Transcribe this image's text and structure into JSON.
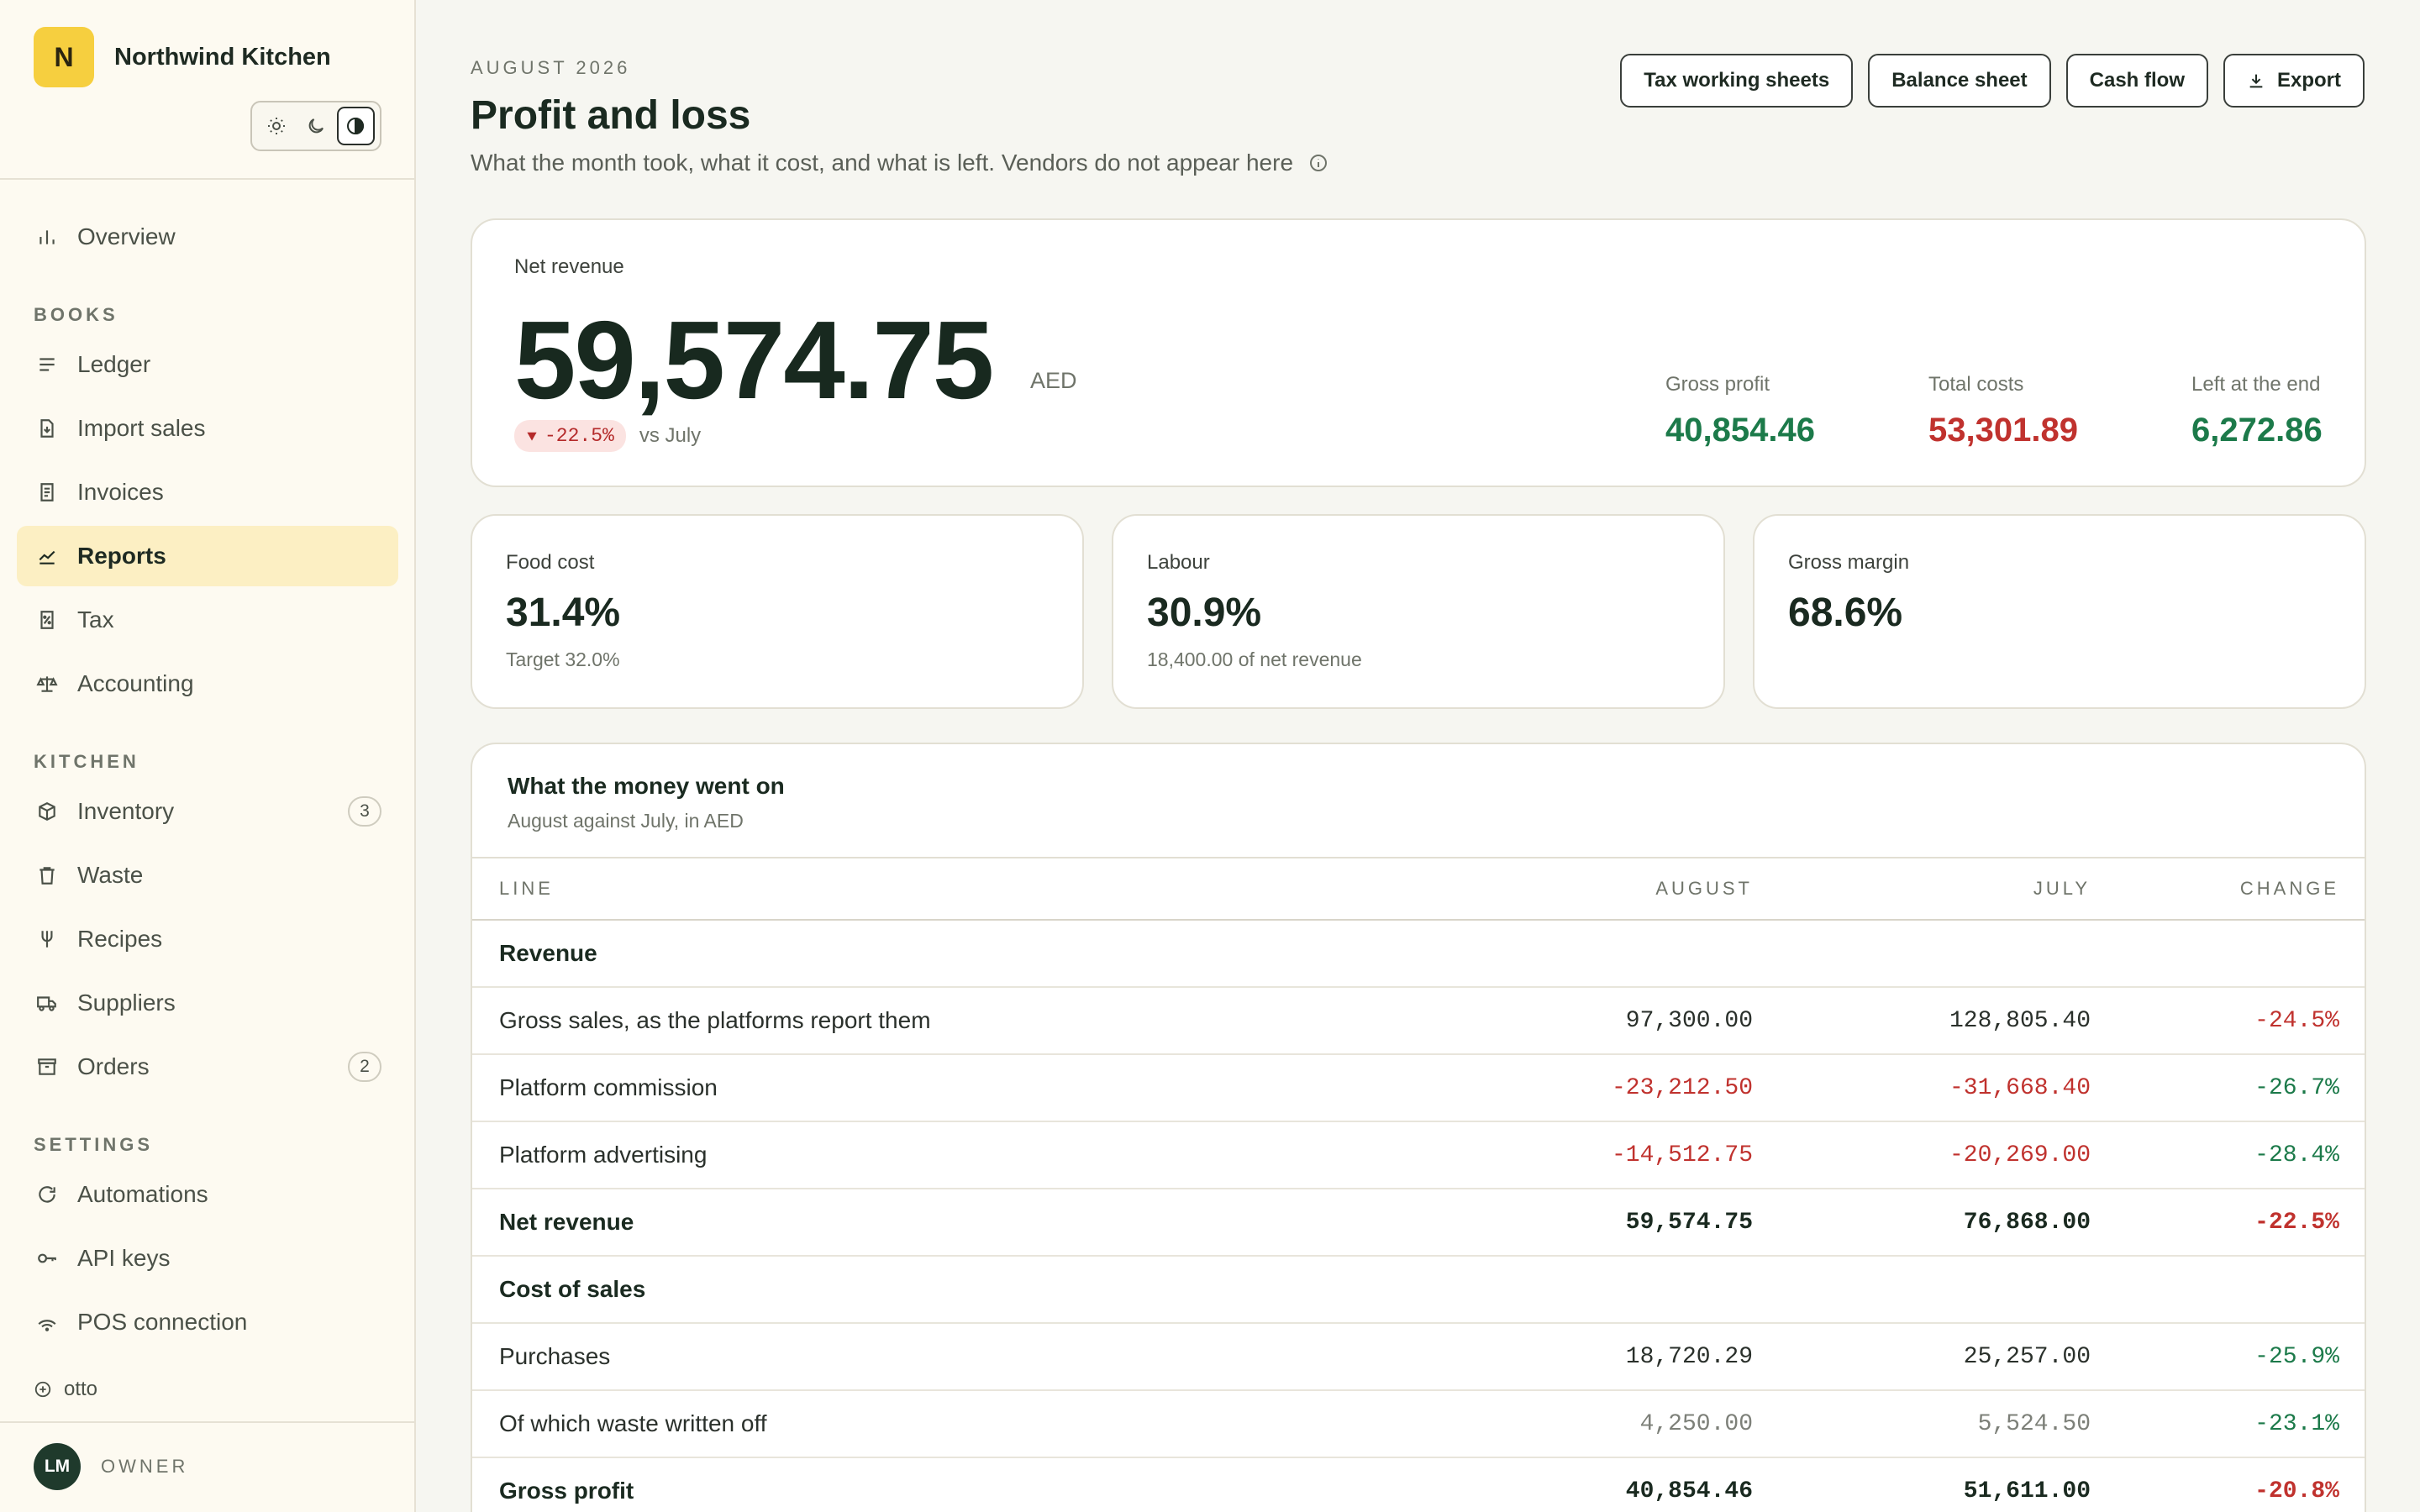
{
  "brand": {
    "initial": "N",
    "name": "Northwind Kitchen"
  },
  "nav": {
    "overview": "Overview",
    "sections": {
      "books": "BOOKS",
      "kitchen": "KITCHEN",
      "settings": "SETTINGS"
    },
    "books": [
      "Ledger",
      "Import sales",
      "Invoices",
      "Reports",
      "Tax",
      "Accounting"
    ],
    "kitchen": [
      "Inventory",
      "Waste",
      "Recipes",
      "Suppliers",
      "Orders"
    ],
    "settings": [
      "Automations",
      "API keys",
      "POS connection"
    ],
    "badges": {
      "inventory": "3",
      "orders": "2"
    },
    "active": "Reports"
  },
  "footer": {
    "otto": "otto",
    "user_initials": "LM",
    "user_role": "OWNER"
  },
  "header": {
    "eyebrow": "AUGUST 2026",
    "title": "Profit and loss",
    "subtitle": "What the month took, what it cost, and what is left. Vendors do not appear here",
    "actions": [
      "Tax working sheets",
      "Balance sheet",
      "Cash flow",
      "Export"
    ]
  },
  "hero": {
    "label": "Net revenue",
    "value": "59,574.75",
    "unit": "AED",
    "change": "-22.5%",
    "change_caption": "vs July",
    "stats": [
      {
        "label": "Gross profit",
        "value": "40,854.46",
        "tone": "pos"
      },
      {
        "label": "Total costs",
        "value": "53,301.89",
        "tone": "neg"
      },
      {
        "label": "Left at the end",
        "value": "6,272.86",
        "tone": "pos"
      }
    ]
  },
  "kpis": [
    {
      "label": "Food cost",
      "value": "31.4%",
      "note": "Target 32.0%"
    },
    {
      "label": "Labour",
      "value": "30.9%",
      "note": "18,400.00 of net revenue"
    },
    {
      "label": "Gross margin",
      "value": "68.6%",
      "note": ""
    }
  ],
  "table": {
    "title": "What the money went on",
    "subtitle": "August against July, in AED",
    "columns": [
      "LINE",
      "AUGUST",
      "JULY",
      "CHANGE"
    ],
    "rows": [
      {
        "line": "Revenue",
        "aug": "",
        "jul": "",
        "chg": "",
        "kind": "section"
      },
      {
        "line": "Gross sales, as the platforms report them",
        "aug": "97,300.00",
        "jul": "128,805.40",
        "chg": "-24.5%",
        "kind": "normal"
      },
      {
        "line": "Platform commission",
        "aug": "-23,212.50",
        "jul": "-31,668.40",
        "chg": "-26.7%",
        "kind": "cost"
      },
      {
        "line": "Platform advertising",
        "aug": "-14,512.75",
        "jul": "-20,269.00",
        "chg": "-28.4%",
        "kind": "cost"
      },
      {
        "line": "Net revenue",
        "aug": "59,574.75",
        "jul": "76,868.00",
        "chg": "-22.5%",
        "kind": "total"
      },
      {
        "line": "Cost of sales",
        "aug": "",
        "jul": "",
        "chg": "",
        "kind": "section"
      },
      {
        "line": "Purchases",
        "aug": "18,720.29",
        "jul": "25,257.00",
        "chg": "-25.9%",
        "kind": "costplain"
      },
      {
        "line": "Of which waste written off",
        "aug": "4,250.00",
        "jul": "5,524.50",
        "chg": "-23.1%",
        "kind": "muted"
      },
      {
        "line": "Gross profit",
        "aug": "40,854.46",
        "jul": "51,611.00",
        "chg": "-20.8%",
        "kind": "total"
      }
    ]
  },
  "colors": {
    "accent": "#f6cf3f",
    "active_nav": "#fcefc3",
    "positive": "#1c7a4a",
    "negative": "#c0322e"
  }
}
